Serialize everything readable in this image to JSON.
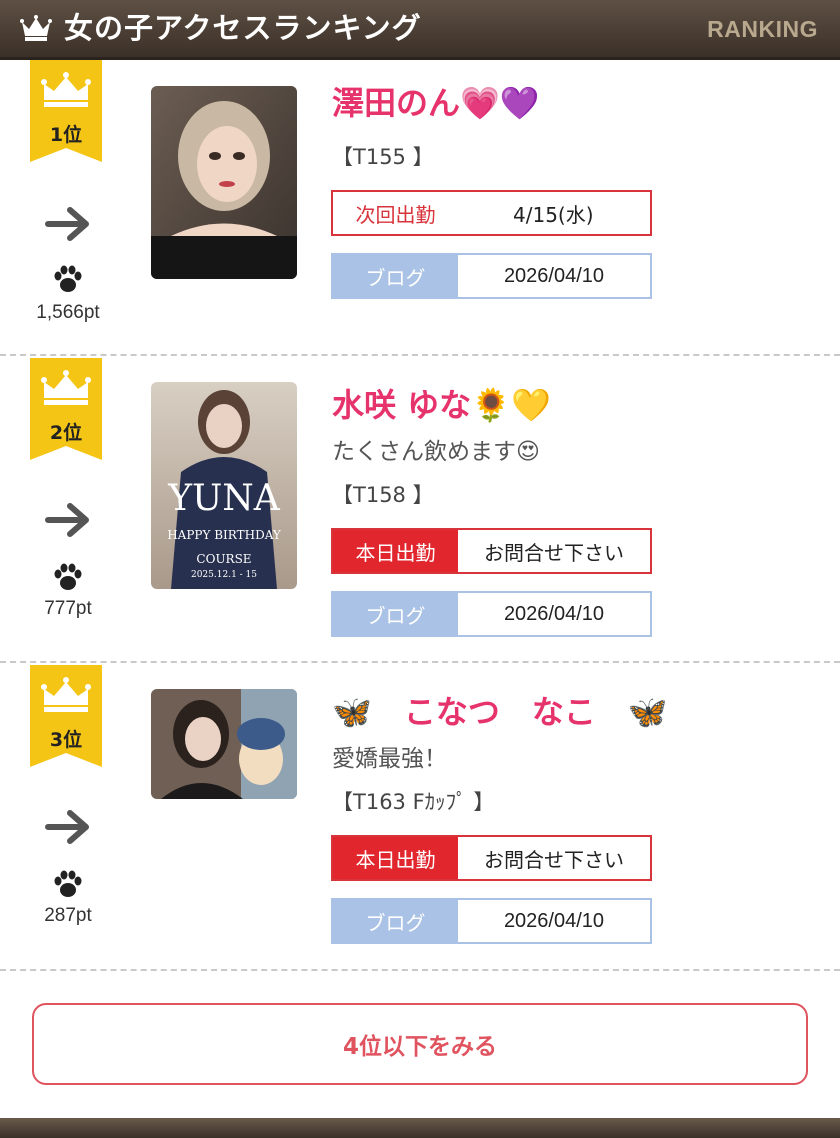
{
  "header": {
    "title": "女の子アクセスランキング",
    "subtitle_en": "RANKING",
    "crown_icon": "crown-icon"
  },
  "colors": {
    "header_bg": "#4a3d33",
    "name": "#e6336b",
    "badge": "#f5c516",
    "shift_red": "#e2262e",
    "blog_blue": "#a9c2e6",
    "more_border": "#e05460"
  },
  "entries": [
    {
      "rank": "1位",
      "trend_icon": "arrow-right-icon",
      "points": "1,566pt",
      "name": "澤田のん💗💜",
      "catch": "",
      "spec": "【T155 】",
      "shift_label": "次回出勤",
      "shift_value": "4/15(水)",
      "shift_type": "next",
      "blog_label": "ブログ",
      "blog_date": "2026/04/10"
    },
    {
      "rank": "2位",
      "trend_icon": "arrow-right-icon",
      "points": "777pt",
      "name": "水咲 ゆな🌻💛",
      "photo_text": "YUNA",
      "photo_sub": "HAPPY BIRTHDAY",
      "photo_course": "COURSE",
      "photo_date": "2025.12.1 - 15",
      "catch": "たくさん飲めます😍",
      "spec": "【T158 】",
      "shift_label": "本日出勤",
      "shift_value": "お問合せ下さい",
      "shift_type": "today",
      "blog_label": "ブログ",
      "blog_date": "2026/04/10"
    },
    {
      "rank": "3位",
      "trend_icon": "arrow-right-icon",
      "points": "287pt",
      "name": "🦋　こなつ　なこ　🦋",
      "catch": "愛嬌最強！",
      "spec": "【T163 Fｶｯﾌﾟ 】",
      "shift_label": "本日出勤",
      "shift_value": "お問合せ下さい",
      "shift_type": "today",
      "blog_label": "ブログ",
      "blog_date": "2026/04/10"
    }
  ],
  "more_button": "4位以下をみる"
}
